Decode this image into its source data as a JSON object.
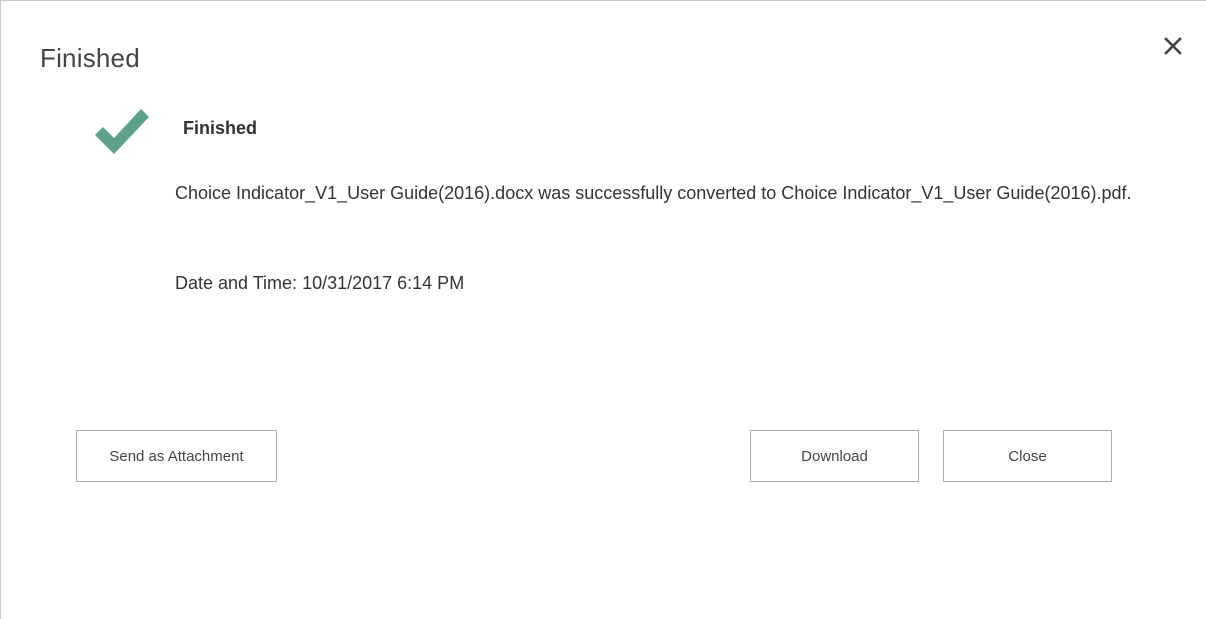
{
  "dialog": {
    "title": "Finished",
    "close_icon": "close-icon"
  },
  "status": {
    "icon": "checkmark-icon",
    "icon_color": "#5fa08d",
    "heading": "Finished",
    "message": "Choice Indicator_V1_User Guide(2016).docx was successfully converted to Choice Indicator_V1_User Guide(2016).pdf.",
    "datetime": "Date and Time: 10/31/2017 6:14 PM"
  },
  "buttons": {
    "send_attachment": "Send as Attachment",
    "download": "Download",
    "close": "Close"
  }
}
